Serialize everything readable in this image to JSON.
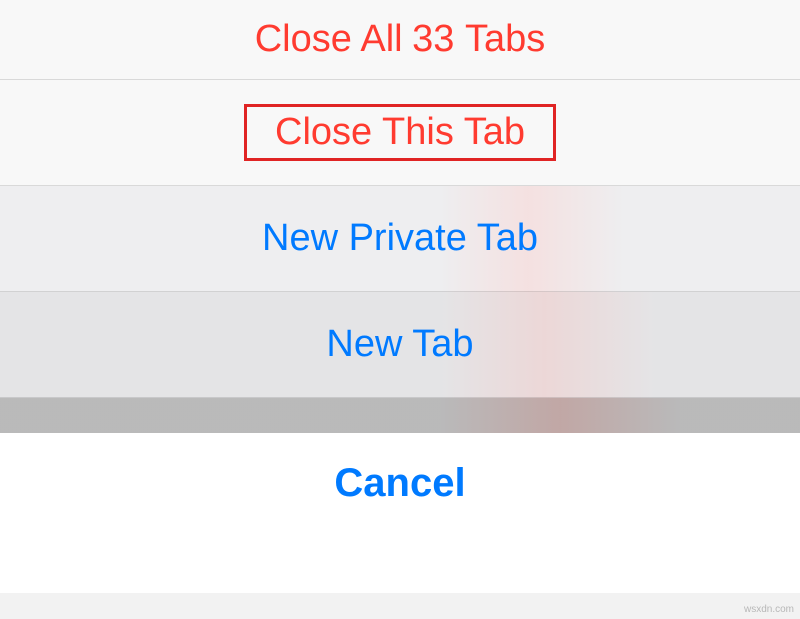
{
  "actions": {
    "close_all": {
      "prefix": "Close All",
      "count": "33",
      "suffix": "Tabs"
    },
    "close_this": "Close This Tab",
    "new_private": "New Private Tab",
    "new_tab": "New Tab"
  },
  "cancel": "Cancel",
  "watermark": "wsxdn.com"
}
